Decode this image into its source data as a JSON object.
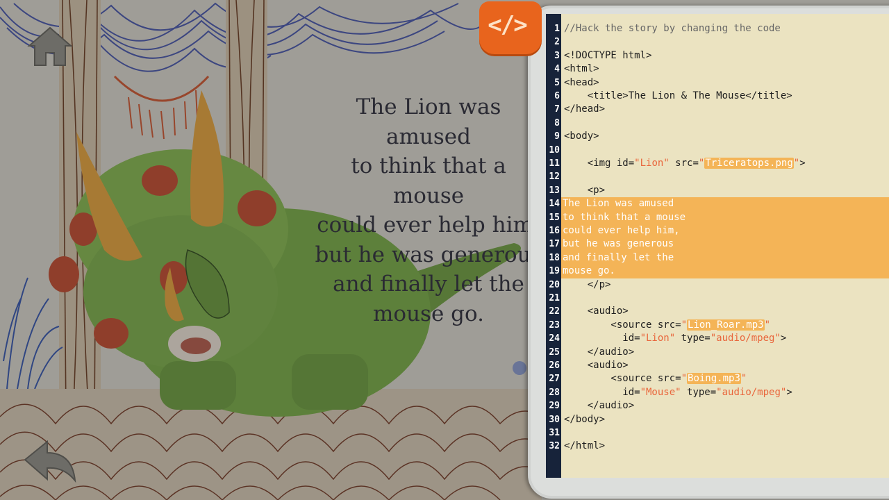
{
  "story": {
    "text": "The Lion was amused\nto think that a mouse\ncould ever help him,\nbut he was generous\nand finally let the\nmouse go."
  },
  "nav": {
    "home_icon": "home-icon",
    "back_icon": "back-arrow-icon"
  },
  "code_toggle": {
    "label": "</>",
    "icon": "code-icon"
  },
  "editor": {
    "comment": "//Hack the story by changing the code",
    "doctype": "<!DOCTYPE html>",
    "html_open": "<html>",
    "head_open": "<head>",
    "title_line": "    <title>The Lion & The Mouse</title>",
    "head_close": "</head>",
    "body_open": "<body>",
    "img": {
      "prefix": "    <img id=",
      "id": "\"Lion\"",
      "mid": " src=",
      "src_q1": "\"",
      "src": "Triceratops.png",
      "src_q2": "\"",
      "suffix": ">"
    },
    "p_open": "    <p>",
    "p_lines": [
      "The Lion was amused",
      "to think that a mouse",
      "could ever help him,",
      "but he was generous",
      "and finally let the",
      "mouse go."
    ],
    "p_close": "    </p>",
    "audio_open": "    <audio>",
    "audio_close": "    </audio>",
    "source_prefix": "        <source src=",
    "audio1": {
      "q1": "\"",
      "src": "Lion_Roar.mp3",
      "q2": "\"",
      "id_prefix": "          id=",
      "id": "\"Lion\"",
      "type_label": " type=",
      "type": "\"audio/mpeg\"",
      "end": ">"
    },
    "audio2": {
      "q1": "\"",
      "src": "Boing.mp3",
      "q2": "\"",
      "id_prefix": "          id=",
      "id": "\"Mouse\"",
      "type_label": " type=",
      "type": "\"audio/mpeg\"",
      "end": ">"
    },
    "body_close": "</body>",
    "html_close": "</html>",
    "line_numbers": [
      "1",
      "2",
      "3",
      "4",
      "5",
      "6",
      "7",
      "8",
      "9",
      "10",
      "11",
      "12",
      "13",
      "14",
      "15",
      "16",
      "17",
      "18",
      "19",
      "20",
      "21",
      "22",
      "23",
      "24",
      "25",
      "26",
      "27",
      "28",
      "29",
      "30",
      "31",
      "32"
    ]
  },
  "colors": {
    "accent_orange": "#e8641d",
    "highlight": "#f4b457",
    "string": "#e9663c",
    "gutter": "#17233a",
    "editor_bg": "#ebe3c1"
  }
}
